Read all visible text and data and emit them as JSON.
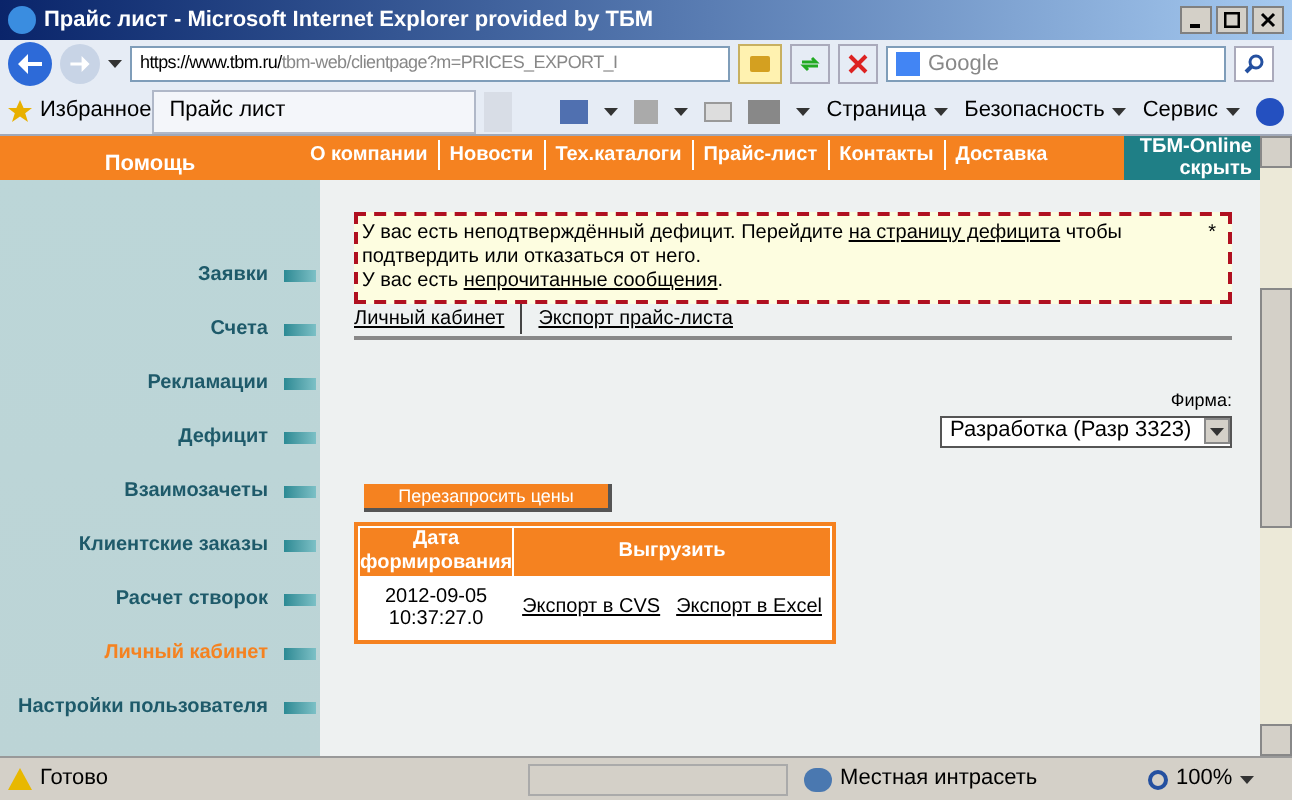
{
  "window": {
    "title": "Прайс лист - Microsoft Internet Explorer provided by ТБМ"
  },
  "address": {
    "value_host": "https://www.tbm.ru/",
    "value_path": "tbm-web/clientpage?m=PRICES_EXPORT_I"
  },
  "search": {
    "placeholder": "Google"
  },
  "favorites": {
    "label": "Избранное",
    "tab": "Прайс лист"
  },
  "toolbar": [
    "Страница",
    "Безопасность",
    "Сервис"
  ],
  "help": "Помощь",
  "nav": [
    {
      "label": "О компании"
    },
    {
      "label": "Новости"
    },
    {
      "label": "Тех.каталоги"
    },
    {
      "label": "Прайс-лист"
    },
    {
      "label": "Контакты"
    },
    {
      "label": "Доставка"
    }
  ],
  "online": {
    "title": "ТБМ-Online",
    "hide": "скрыть"
  },
  "sidebar": {
    "items": [
      {
        "label": "Заявки",
        "selected": false
      },
      {
        "label": "Счета",
        "selected": false
      },
      {
        "label": "Рекламации",
        "selected": false
      },
      {
        "label": "Дефицит",
        "selected": false
      },
      {
        "label": "Взаимозачеты",
        "selected": false
      },
      {
        "label": "Клиентские заказы",
        "selected": false
      },
      {
        "label": "Расчет створок",
        "selected": false
      },
      {
        "label": "Личный кабинет",
        "selected": true
      },
      {
        "label": "Настройки пользователя",
        "selected": false
      }
    ]
  },
  "notice": {
    "line1_pre": "У вас есть неподтверждённый дефицит. Перейдите ",
    "line1_link": "на страницу дефицита",
    "line1_post": " чтобы подтвердить или отказаться от него.",
    "line2_pre": "У вас есть ",
    "line2_link": "непрочитанные сообщения",
    "line2_post": ".",
    "mark": "*"
  },
  "breadcrumbs": [
    "Личный кабинет",
    "Экспорт прайс-листа"
  ],
  "firm": {
    "label": "Фирма:",
    "value": "Разработка (Разр 3323)"
  },
  "refresh_button": "Перезапросить цены",
  "table": {
    "columns": [
      "Дата формирования",
      "Выгрузить"
    ],
    "rows": [
      {
        "date": "2012-09-05 10:37:27.0",
        "links": [
          "Экспорт в CVS",
          "Экспорт в Excel"
        ]
      }
    ]
  },
  "status_bar": {
    "text": "Готово",
    "zone": "Местная интрасеть",
    "zoom": "100%"
  }
}
